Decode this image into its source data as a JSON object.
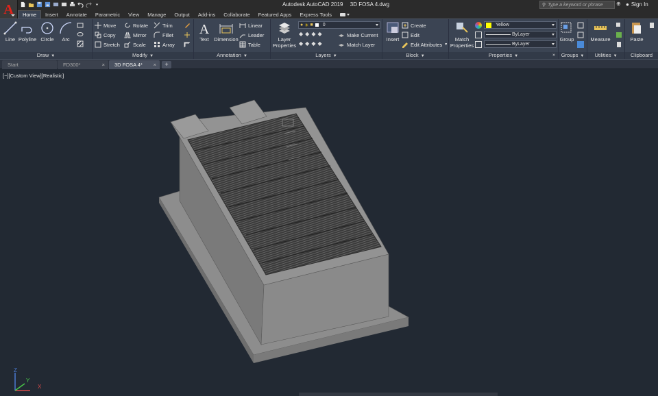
{
  "app": {
    "logo_letter": "A",
    "title": "Autodesk AutoCAD 2019",
    "document": "3D FOSA 4.dwg",
    "search_placeholder": "Type a keyword or phrase",
    "sign_in": "Sign In"
  },
  "ribbon_tabs": [
    "Home",
    "Insert",
    "Annotate",
    "Parametric",
    "View",
    "Manage",
    "Output",
    "Add-ins",
    "Collaborate",
    "Featured Apps",
    "Express Tools"
  ],
  "ribbon_active_tab": "Home",
  "panels": {
    "draw": {
      "label": "Draw",
      "line": "Line",
      "polyline": "Polyline",
      "circle": "Circle",
      "arc": "Arc"
    },
    "modify": {
      "label": "Modify",
      "move": "Move",
      "rotate": "Rotate",
      "trim": "Trim",
      "copy": "Copy",
      "mirror": "Mirror",
      "fillet": "Fillet",
      "stretch": "Stretch",
      "scale": "Scale",
      "array": "Array"
    },
    "annotation": {
      "label": "Annotation",
      "text": "Text",
      "dimension": "Dimension",
      "linear": "Linear",
      "leader": "Leader",
      "table": "Table"
    },
    "layers": {
      "label": "Layers",
      "layer_properties": "Layer Properties",
      "current_layer": "0",
      "make_current": "Make Current",
      "match_layer": "Match Layer"
    },
    "block": {
      "label": "Block",
      "insert": "Insert",
      "create": "Create",
      "edit": "Edit",
      "edit_attributes": "Edit Attributes"
    },
    "properties": {
      "label": "Properties",
      "match_properties": "Match Properties",
      "color": "Yellow",
      "linetype": "ByLayer",
      "lineweight": "ByLayer"
    },
    "groups": {
      "label": "Groups",
      "group": "Group"
    },
    "utilities": {
      "label": "Utilities",
      "measure": "Measure"
    },
    "clipboard": {
      "label": "Clipboard",
      "paste": "Paste"
    }
  },
  "doc_tabs": [
    "Start",
    "FD300*",
    "3D FOSA 4*"
  ],
  "doc_active_tab": "3D FOSA 4*",
  "viewport": {
    "label": "[−][Custom View][Realistic]"
  },
  "colors": {
    "accent_yellow": "#ffff00",
    "viewport_bg": "#222933",
    "ribbon_bg": "#3b4453",
    "model_gray": "#8c8c8c"
  }
}
